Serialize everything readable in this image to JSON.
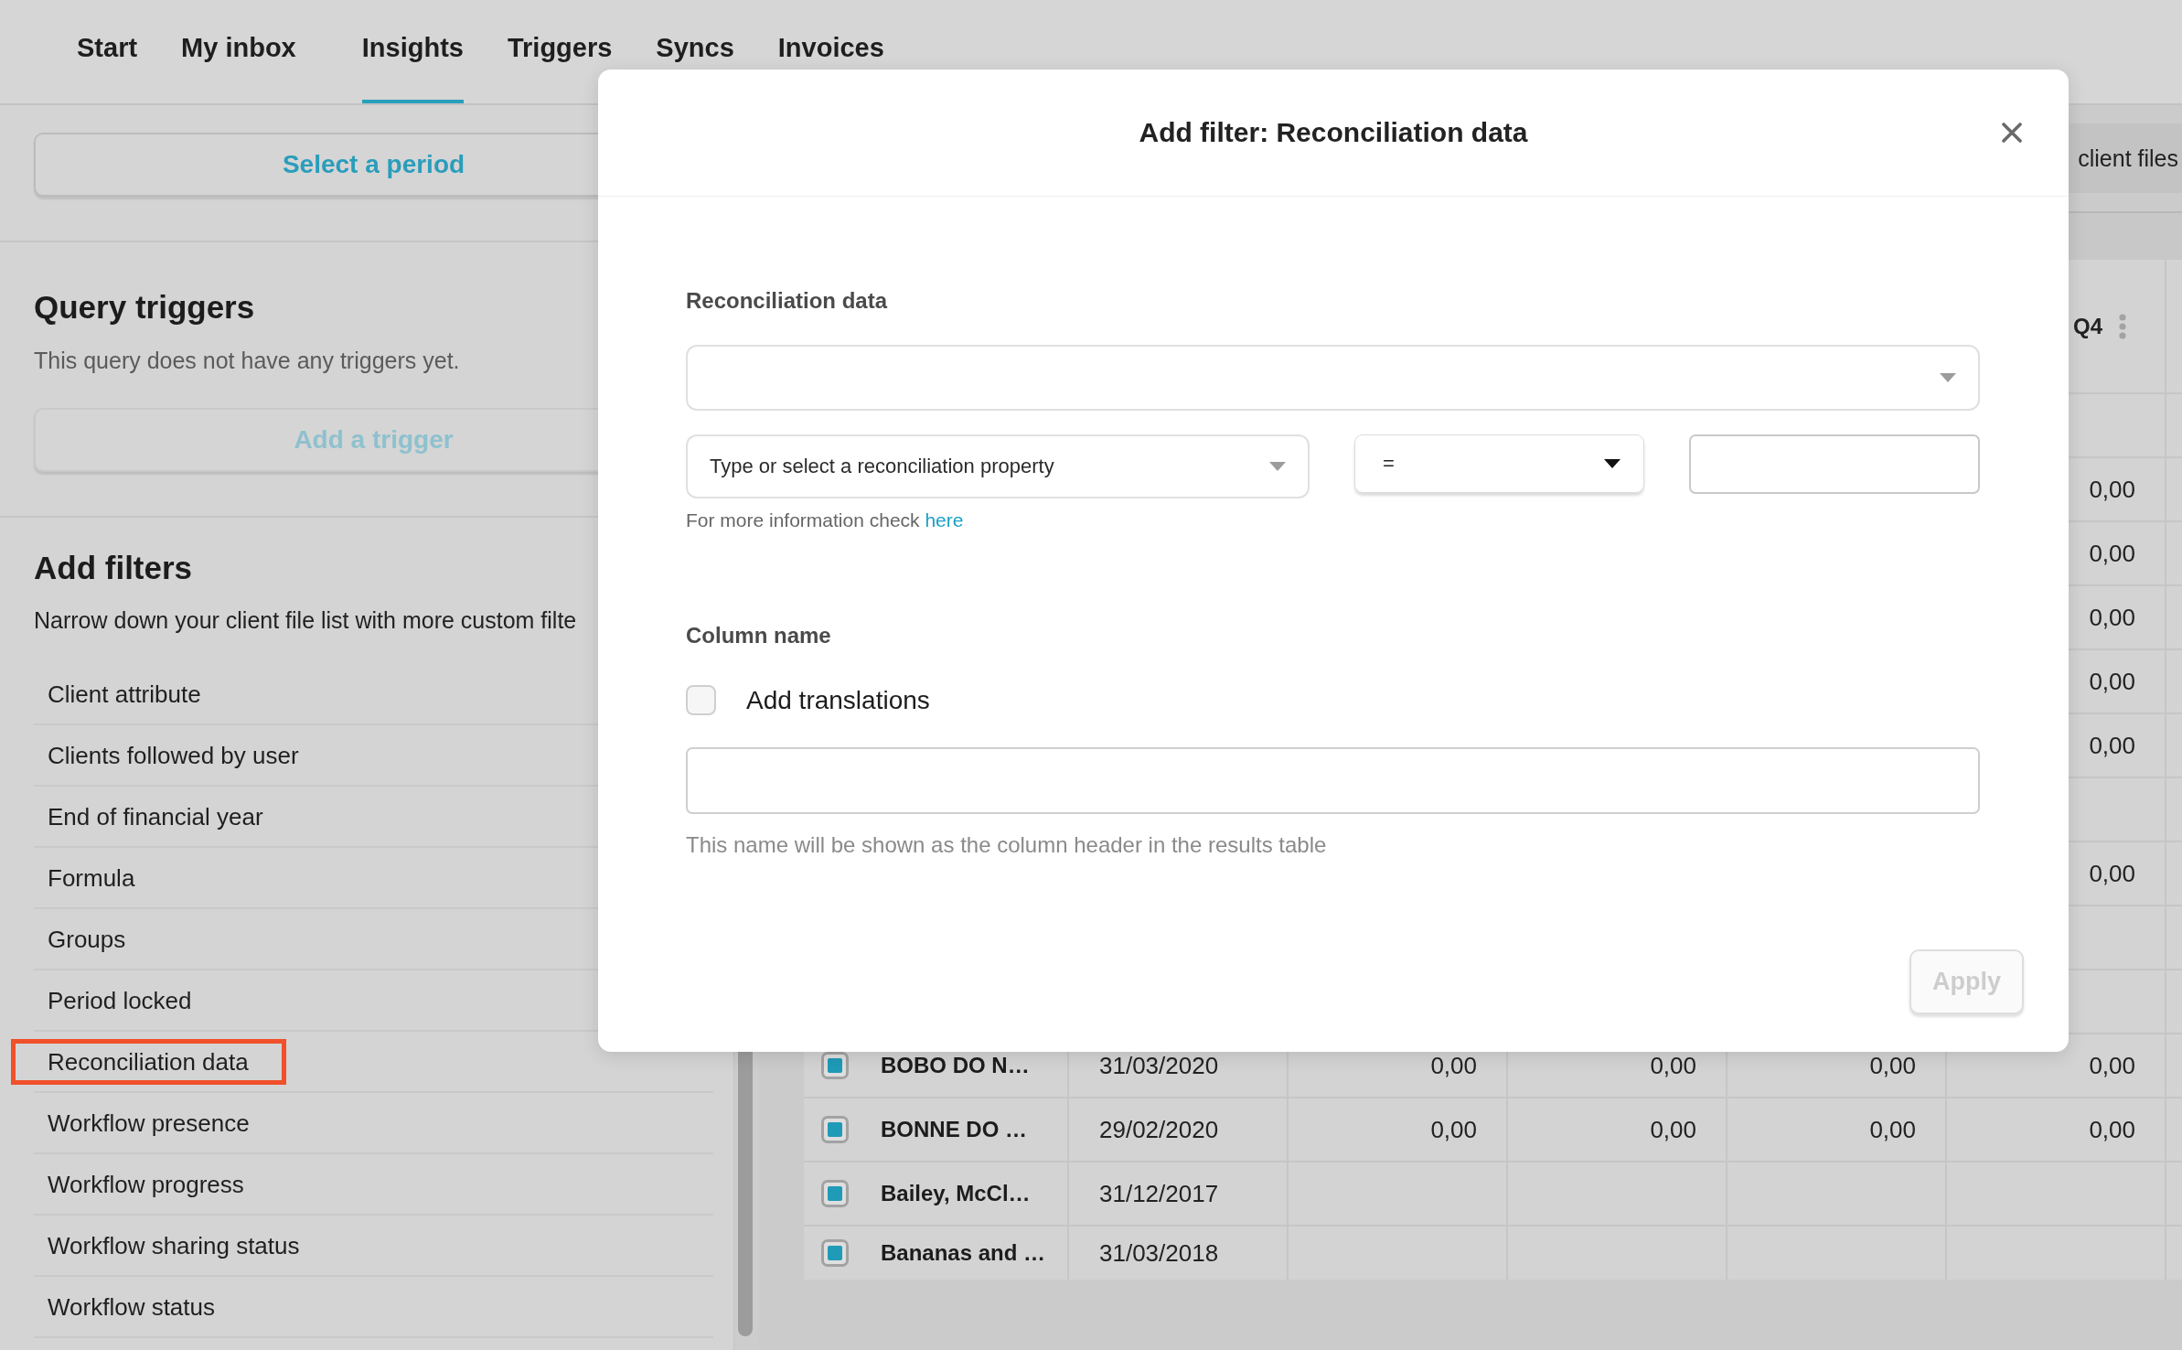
{
  "nav": {
    "tabs": [
      {
        "label": "Start",
        "selected": false
      },
      {
        "label": "My inbox",
        "selected": false
      },
      {
        "label": "Insights",
        "selected": true
      },
      {
        "label": "Triggers",
        "selected": false
      },
      {
        "label": "Syncs",
        "selected": false
      },
      {
        "label": "Invoices",
        "selected": false
      }
    ]
  },
  "left_panel": {
    "period_button": {
      "label": "Select a period",
      "disabled": false
    },
    "query_triggers": {
      "title": "Query triggers",
      "text": "This query does not have any triggers yet.",
      "button": {
        "label": "Add a trigger",
        "disabled": true
      }
    },
    "filters": {
      "title": "Add filters",
      "description": "Narrow down your client file list with more custom filte",
      "items": [
        {
          "label": "Client attribute",
          "highlighted": false
        },
        {
          "label": "Clients followed by user",
          "highlighted": false
        },
        {
          "label": "End of financial year",
          "highlighted": false
        },
        {
          "label": "Formula",
          "highlighted": false
        },
        {
          "label": "Groups",
          "highlighted": false
        },
        {
          "label": "Period locked",
          "highlighted": false
        },
        {
          "label": "Reconciliation data",
          "highlighted": true
        },
        {
          "label": "Workflow presence",
          "highlighted": false
        },
        {
          "label": "Workflow progress",
          "highlighted": false
        },
        {
          "label": "Workflow sharing status",
          "highlighted": false
        },
        {
          "label": "Workflow status",
          "highlighted": false
        }
      ]
    }
  },
  "results": {
    "toolbar_button": "client files",
    "table": {
      "header": "Q4",
      "rows": [
        {
          "q4": null
        },
        {
          "q4": "0,00"
        },
        {
          "q4": "0,00"
        },
        {
          "q4": "0,00"
        },
        {
          "q4": "0,00"
        },
        {
          "q4": "0,00"
        },
        {
          "q4": null
        },
        {
          "q4": "0,00"
        },
        {
          "q4": null
        },
        {
          "q4": null
        },
        {
          "checked": true,
          "name": "BOBO DO N…",
          "date": "31/03/2020",
          "values": [
            "0,00",
            "0,00",
            "0,00",
            "0,00"
          ]
        },
        {
          "checked": true,
          "name": "BONNE DO …",
          "date": "29/02/2020",
          "values": [
            "0,00",
            "0,00",
            "0,00",
            "0,00"
          ]
        },
        {
          "checked": true,
          "name": "Bailey, McCl…",
          "date": "31/12/2017"
        },
        {
          "checked": true,
          "name": "Bananas and …",
          "date": "31/03/2018"
        }
      ]
    }
  },
  "modal": {
    "title": "Add filter: Reconciliation data",
    "source": {
      "label": "Reconciliation data"
    },
    "condition": {
      "placeholder": "Type or select a reconciliation property",
      "operator": "="
    },
    "help": {
      "text": "For more information check",
      "link": "here"
    },
    "column_name": {
      "label": "Column name",
      "translations": {
        "label": "Add translations",
        "checked": false
      },
      "hint": "This name will be shown as the column header in the results table"
    },
    "apply": {
      "label": "Apply",
      "disabled": true
    }
  }
}
